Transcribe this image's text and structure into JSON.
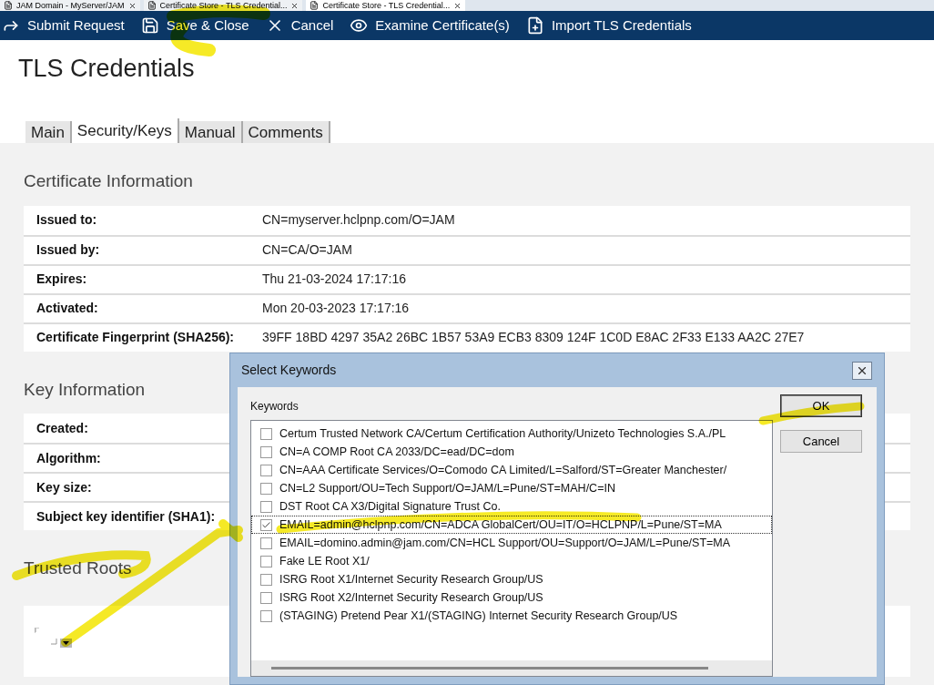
{
  "window_tabs": [
    {
      "label": "JAM Domain - MyServer/JAM",
      "selected": false
    },
    {
      "label": "Certificate Store - TLS Credential...",
      "selected": false
    },
    {
      "label": "Certificate Store - TLS Credential...",
      "selected": true
    }
  ],
  "toolbar": [
    {
      "kind": "submit",
      "label": "Submit Request"
    },
    {
      "kind": "save",
      "label": "Save & Close"
    },
    {
      "kind": "cancel",
      "label": "Cancel"
    },
    {
      "kind": "examine",
      "label": "Examine Certificate(s)"
    },
    {
      "kind": "import",
      "label": "Import TLS Credentials"
    }
  ],
  "title": "TLS Credentials",
  "tabs": [
    {
      "label": "Main",
      "selected": false
    },
    {
      "label": "Security/Keys",
      "selected": true
    },
    {
      "label": "Manual",
      "selected": false
    },
    {
      "label": "Comments",
      "selected": false
    }
  ],
  "certificate_information": {
    "heading": "Certificate Information",
    "rows": [
      {
        "label": "Issued to:",
        "value": "CN=myserver.hclpnp.com/O=JAM"
      },
      {
        "label": "Issued by:",
        "value": "CN=CA/O=JAM"
      },
      {
        "label": "Expires:",
        "value": "Thu 21-03-2024 17:17:16"
      },
      {
        "label": "Activated:",
        "value": "Mon 20-03-2023 17:17:16"
      },
      {
        "label": "Certificate Fingerprint (SHA256):",
        "value": "39FF 18BD 4297 35A2 26BC 1B57 53A9 ECB3 8309 124F 1C0D E8AC 2F33 E133 AA2C 27E7"
      }
    ]
  },
  "key_information": {
    "heading": "Key Information",
    "rows": [
      {
        "label": "Created:"
      },
      {
        "label": "Algorithm:"
      },
      {
        "label": "Key size:"
      },
      {
        "label": "Subject key identifier (SHA1):"
      }
    ]
  },
  "trusted_roots": {
    "heading": "Trusted Roots"
  },
  "dialog": {
    "title": "Select Keywords",
    "list_label": "Keywords",
    "buttons": [
      "OK",
      "Cancel"
    ],
    "items": [
      {
        "label": "Certum Trusted Network CA/Certum Certification Authority/Unizeto Technologies S.A./PL",
        "checked": false
      },
      {
        "label": "CN=A COMP Root CA 2033/DC=ead/DC=dom",
        "checked": false
      },
      {
        "label": "CN=AAA Certificate Services/O=Comodo CA Limited/L=Salford/ST=Greater Manchester/",
        "checked": false
      },
      {
        "label": "CN=L2 Support/OU=Tech Support/O=JAM/L=Pune/ST=MAH/C=IN",
        "checked": false
      },
      {
        "label": "DST Root CA X3/Digital Signature Trust Co.",
        "checked": false
      },
      {
        "label": "EMAIL=admin@hclpnp.com/CN=ADCA GlobalCert/OU=IT/O=HCLPNP/L=Pune/ST=MA",
        "checked": true
      },
      {
        "label": "EMAIL=domino.admin@jam.com/CN=HCL Support/OU=Support/O=JAM/L=Pune/ST=MA",
        "checked": false
      },
      {
        "label": "Fake LE Root X1/",
        "checked": false
      },
      {
        "label": "ISRG Root X1/Internet Security Research Group/US",
        "checked": false
      },
      {
        "label": "ISRG Root X2/Internet Security Research Group/US",
        "checked": false
      },
      {
        "label": "(STAGING) Pretend Pear X1/(STAGING) Internet Security Research Group/US",
        "checked": false
      }
    ]
  }
}
